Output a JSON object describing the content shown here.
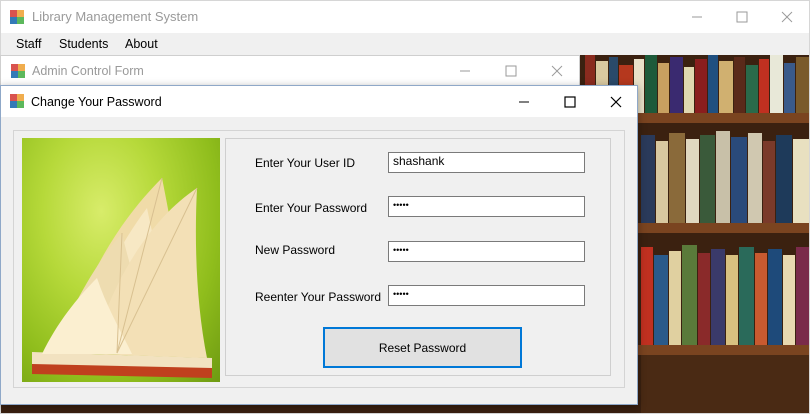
{
  "main_window": {
    "title": "Library Management System",
    "menu": [
      "Staff",
      "Students",
      "About"
    ]
  },
  "admin_window": {
    "title": "Admin Control Form"
  },
  "dialog": {
    "title": "Change Your Password",
    "fields": [
      {
        "label": "Enter Your User ID",
        "value": "shashank"
      },
      {
        "label": "Enter Your Password",
        "value": "•••••"
      },
      {
        "label": "New Password",
        "value": "•••••"
      },
      {
        "label": "Reenter Your Password",
        "value": "•••••"
      }
    ],
    "reset_button": "Reset Password"
  },
  "icons": {
    "app": "app-icon",
    "minimize": "minimize-icon",
    "maximize": "maximize-icon",
    "close": "close-icon"
  },
  "colors": {
    "accent": "#0078d7",
    "window_bg": "#f0f0f0"
  }
}
